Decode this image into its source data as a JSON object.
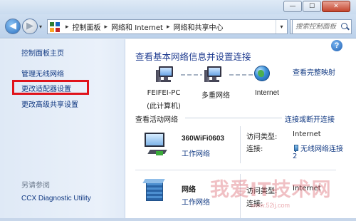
{
  "titlebar": {
    "min_label": "—",
    "max_label": "☐",
    "close_label": "✕"
  },
  "address_bar": {
    "back_glyph": "◀",
    "forward_glyph": "▶",
    "breadcrumb": [
      "控制面板",
      "网络和 Internet",
      "网络和共享中心"
    ],
    "separator": "▸",
    "dropdown_glyph": "▾",
    "refresh_glyph": "⟳",
    "search_placeholder": "搜索控制面板"
  },
  "sidebar": {
    "items": [
      {
        "label": "控制面板主页"
      },
      {
        "label": "管理无线网络"
      },
      {
        "label": "更改适配器设置",
        "highlighted": true,
        "highlight_color": "#e0131b"
      },
      {
        "label": "更改高级共享设置"
      }
    ],
    "see_also_label": "另请参阅",
    "see_also_items": [
      {
        "label": "CCX Diagnostic Utility"
      }
    ]
  },
  "main": {
    "help_glyph": "?",
    "title": "查看基本网络信息并设置连接",
    "full_map_link": "查看完整映射",
    "nodes": {
      "computer_line1": "FEIFEI-PC",
      "computer_line2": "(此计算机)",
      "multiple_networks": "多重网络",
      "internet": "Internet"
    },
    "active_networks_heading": "查看活动网络",
    "connect_link": "连接或断开连接",
    "networks": [
      {
        "name": "360WiFi0603",
        "type": "工作网络",
        "access_type_label": "访问类型:",
        "access_type_value": "Internet",
        "connection_label": "连接:",
        "connection_value_line1": "无线网络连接",
        "connection_value_line2": "2"
      },
      {
        "name": "网络",
        "type": "工作网络",
        "access_type_label": "访问类型:",
        "access_type_value": "Internet",
        "connection_label": "连接:"
      }
    ]
  },
  "watermark": {
    "text": "我爱IT技术网",
    "url": "www.52ij.com"
  },
  "colors": {
    "link": "#123a83",
    "title": "#1d3a8f",
    "highlight_box": "#e0131b"
  }
}
